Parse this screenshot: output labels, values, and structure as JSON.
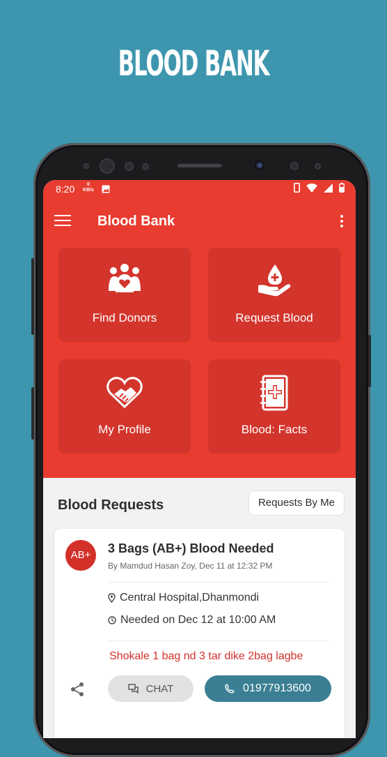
{
  "promo": {
    "title": "BLOOD BANK"
  },
  "status_bar": {
    "time": "8:20",
    "kbs_value": "0",
    "kbs_unit": "KB/s"
  },
  "app": {
    "title": "Blood Bank"
  },
  "tiles": [
    {
      "label": "Find Donors",
      "icon": "donors-group-heart-icon"
    },
    {
      "label": "Request Blood",
      "icon": "blood-drop-hand-icon"
    },
    {
      "label": "My Profile",
      "icon": "handshake-heart-icon"
    },
    {
      "label": "Blood: Facts",
      "icon": "medical-notebook-icon"
    }
  ],
  "requests_section": {
    "title": "Blood Requests",
    "filter_button": "Requests By Me"
  },
  "request_card": {
    "blood_group": "AB+",
    "title": "3 Bags (AB+) Blood Needed",
    "posted_by": "By Mamdud Hasan Zoy, Dec 11 at 12:32 PM",
    "location": "Central Hospital,Dhanmondi",
    "needed_on": "Needed on Dec 12 at 10:00 AM",
    "note": "Shokale 1 bag nd 3 tar dike 2bag lagbe",
    "chat_label": "CHAT",
    "phone": "01977913600"
  },
  "colors": {
    "background": "#3d96ae",
    "primary_red": "#e83c30",
    "tile_red": "#d3352c",
    "call_button": "#3a7f93"
  }
}
